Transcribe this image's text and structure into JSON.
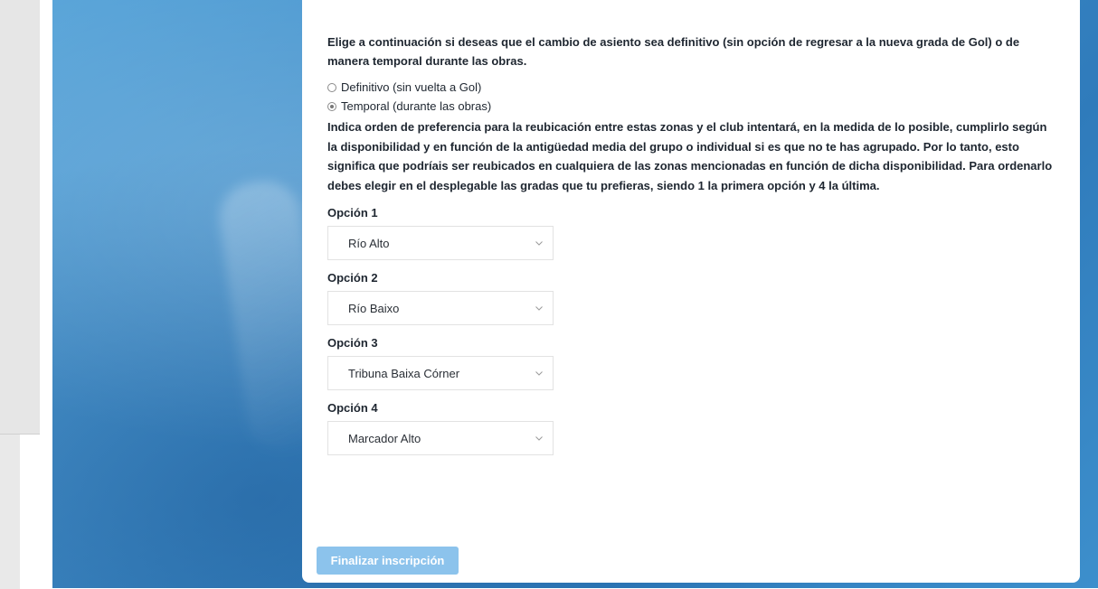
{
  "form": {
    "intro_text": "Elige a continuación si deseas que el cambio de asiento sea definitivo (sin opción de regresar a la nueva grada de Gol) o de manera temporal durante las obras.",
    "radio_options": [
      {
        "label": "Definitivo (sin vuelta a Gol)",
        "checked": false
      },
      {
        "label": "Temporal (durante las obras)",
        "checked": true
      }
    ],
    "preference_text": "Indica orden de preferencia para la reubicación entre estas zonas y el club intentará, en la medida de lo posible, cumplirlo según la disponibilidad y en función de la antigüedad media del grupo o individual si es que no te has agrupado. Por lo tanto, esto significa que podríais ser reubicados en cualquiera de las zonas mencionadas en función de dicha disponibilidad. Para ordenarlo debes elegir en el desplegable las gradas que tu prefieras, siendo 1 la primera opción y 4 la última.",
    "options": [
      {
        "label": "Opción 1",
        "value": "Río Alto"
      },
      {
        "label": "Opción 2",
        "value": "Río Baixo"
      },
      {
        "label": "Opción 3",
        "value": "Tribuna Baixa Córner"
      },
      {
        "label": "Opción 4",
        "value": "Marcador Alto"
      }
    ],
    "submit_label": "Finalizar inscripción"
  },
  "colors": {
    "background_blue": "#3f8cc8",
    "button_color": "#8cc3ec",
    "text_color": "#1e2630"
  },
  "icons": {
    "select_arrow": "chevron-down-icon"
  }
}
